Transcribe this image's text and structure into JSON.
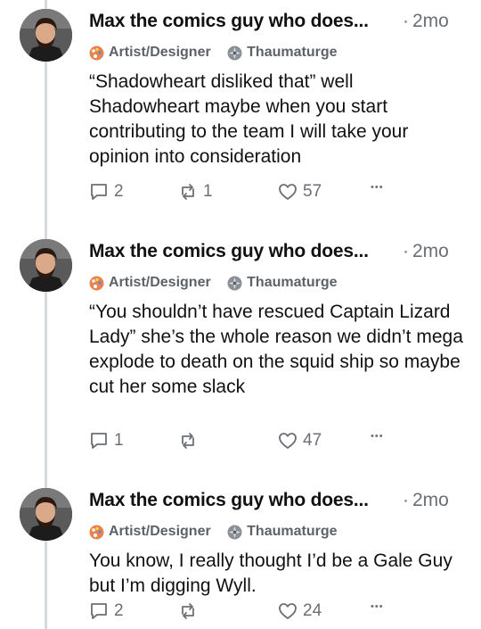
{
  "posts": [
    {
      "author": "Max the comics guy who does...",
      "time": "2mo",
      "badges": [
        {
          "label": "Artist/Designer",
          "icon": "palette-icon"
        },
        {
          "label": "Thaumaturge",
          "icon": "spell-icon"
        }
      ],
      "text": "“Shadowheart disliked that” well Shadowheart maybe when you start contributing to the team I will take your opinion into consideration",
      "replies": "2",
      "reposts": "1",
      "likes": "57"
    },
    {
      "author": "Max the comics guy who does...",
      "time": "2mo",
      "badges": [
        {
          "label": "Artist/Designer",
          "icon": "palette-icon"
        },
        {
          "label": "Thaumaturge",
          "icon": "spell-icon"
        }
      ],
      "text": "“You shouldn’t have rescued Captain Lizard Lady” she’s the whole reason we didn’t mega explode to death on the squid ship so maybe cut her some slack",
      "replies": "1",
      "reposts": "",
      "likes": "47"
    },
    {
      "author": "Max the comics guy who does...",
      "time": "2mo",
      "badges": [
        {
          "label": "Artist/Designer",
          "icon": "palette-icon"
        },
        {
          "label": "Thaumaturge",
          "icon": "spell-icon"
        }
      ],
      "text": "You know, I really thought I’d be a Gale Guy but I’m digging Wyll.",
      "replies": "2",
      "reposts": "",
      "likes": "24"
    }
  ],
  "ui": {
    "time_separator": "·",
    "more_glyph": "•••"
  },
  "colors": {
    "muted": "#6b6f75",
    "thread_line": "#d6d9dd",
    "text": "#111111"
  }
}
